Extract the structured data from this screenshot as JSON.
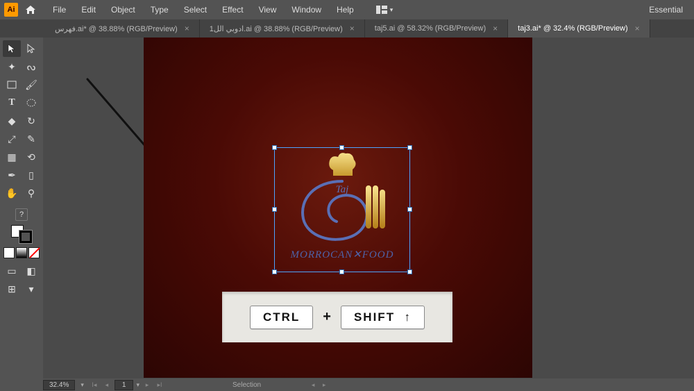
{
  "app": {
    "logo": "Ai",
    "workspace": "Essential"
  },
  "menu": {
    "items": [
      "File",
      "Edit",
      "Object",
      "Type",
      "Select",
      "Effect",
      "View",
      "Window",
      "Help"
    ]
  },
  "tabs": [
    {
      "label": "فهرس.ai* @ 38.88% (RGB/Preview)",
      "active": false
    },
    {
      "label": "ادوبي الل1.ai @ 38.88% (RGB/Preview)",
      "active": false
    },
    {
      "label": "taj5.ai @ 58.32% (RGB/Preview)",
      "active": false
    },
    {
      "label": "taj3.ai* @ 32.4% (RGB/Preview)",
      "active": true
    }
  ],
  "logo": {
    "script_name": "Taj",
    "subline": "MORROCAN✕FOOD"
  },
  "shortcut": {
    "key1": "CTRL",
    "joiner": "+",
    "key2": "SHIFT",
    "arrow": "↑"
  },
  "status": {
    "zoom": "32.4%",
    "page": "1",
    "tool": "Selection"
  }
}
